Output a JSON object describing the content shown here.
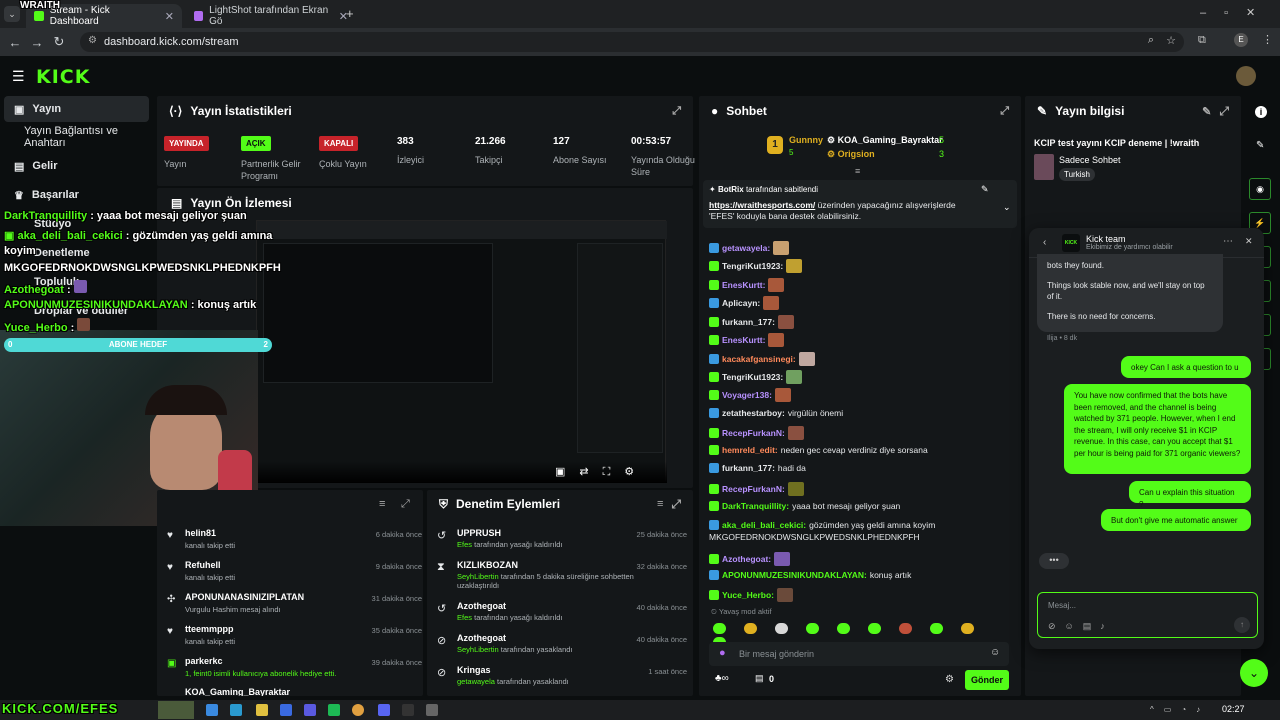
{
  "browser": {
    "tabs": [
      {
        "label": "Stream - Kick Dashboard",
        "active": true
      },
      {
        "label": "LightShot tarafından Ekran Gö",
        "active": false
      }
    ],
    "url": "dashboard.kick.com/stream",
    "profile_initial": "E"
  },
  "overlay": {
    "wraith": "WRAITH",
    "stream_watermark": "KICK.COM/EFES",
    "sub_goal": "ABONE HEDEF",
    "sub_goal_left": "0",
    "sub_goal_right": "2",
    "chat": [
      {
        "user": "DarkTranquillity",
        "text": ": yaaa bot mesajı geliyor şuan"
      },
      {
        "user": "aka_deli_bali_cekici",
        "text": ": gözümden yaş geldi amına"
      },
      {
        "user": "",
        "text": "koyim"
      },
      {
        "user": "",
        "text": "MKGOFEDRNOKDWSNGLKPWEDSNKLPHEDNKPFH"
      },
      {
        "user": "Azothegoat",
        "text": ":"
      },
      {
        "user": "APONUNMUZESINIKUNDAKLAYAN",
        "text": ": konuş artık"
      },
      {
        "user": "Yuce_Herbo",
        "text": ":"
      }
    ]
  },
  "sidebar": {
    "items": [
      {
        "label": "Yayın",
        "icon": "broadcast-icon"
      },
      {
        "label": "Yayın Bağlantısı ve Anahtarı",
        "icon": ""
      },
      {
        "label": "Gelir",
        "icon": "money-icon"
      },
      {
        "label": "Başarılar",
        "icon": "trophy-icon"
      },
      {
        "label": "Stüdyo",
        "icon": "studio-icon"
      },
      {
        "label": "Denetleme",
        "icon": "shield-icon"
      },
      {
        "label": "Topluluk",
        "icon": "people-icon"
      },
      {
        "label": "Droplar ve ödüller",
        "icon": "gift-icon"
      }
    ]
  },
  "stats": {
    "title": "Yayın İstatistikleri",
    "items": [
      {
        "badge": "YAYINDA",
        "label": "Yayın"
      },
      {
        "badge": "AÇIK",
        "label": "Partnerlik Gelir Programı"
      },
      {
        "badge": "KAPALI",
        "label": "Çoklu Yayın"
      },
      {
        "value": "383",
        "label": "İzleyici"
      },
      {
        "value": "21.266",
        "label": "Takipçi"
      },
      {
        "value": "127",
        "label": "Abone Sayısı"
      },
      {
        "value": "00:53:57",
        "label": "Yayında Olduğu Süre"
      }
    ]
  },
  "preview": {
    "title": "Yayın Ön İzlemesi"
  },
  "followers": {
    "items": [
      {
        "name": "helin81",
        "sub": "kanalı takip etti",
        "time": "6 dakika önce",
        "icon": "heart-icon"
      },
      {
        "name": "Refuhell",
        "sub": "kanalı takip etti",
        "time": "9 dakika önce",
        "icon": "heart-icon"
      },
      {
        "name": "APONUNANASINIZIPLATAN",
        "sub": "Vurgulu Hashim mesaj alındı",
        "time": "31 dakika önce",
        "icon": "highlight-icon"
      },
      {
        "name": "tteemmppp",
        "sub": "kanalı takip etti",
        "time": "35 dakika önce",
        "icon": "heart-icon"
      },
      {
        "name": "parkerkc",
        "sub": "1, feint0 isimli kullanıcıya abonelik hediye etti.",
        "time": "39 dakika önce",
        "icon": "gift-icon"
      },
      {
        "name": "KOA_Gaming_Bayraktar",
        "sub": "",
        "time": "",
        "icon": "heart-icon"
      }
    ]
  },
  "moderation": {
    "title": "Denetim Eylemleri",
    "items": [
      {
        "name": "UPPRUSH",
        "actor": "Efes",
        "sub": "tarafından yasağı kaldırıldı",
        "time": "25 dakika önce",
        "icon": "unban-icon"
      },
      {
        "name": "KIZLIKBOZAN",
        "actor": "SeyhLibertin",
        "sub": "tarafından 5 dakika süreliğine sohbetten uzaklaştırıldı",
        "time": "32 dakika önce",
        "icon": "timeout-icon"
      },
      {
        "name": "Azothegoat",
        "actor": "Efes",
        "sub": "tarafından yasağı kaldırıldı",
        "time": "40 dakika önce",
        "icon": "unban-icon"
      },
      {
        "name": "Azothegoat",
        "actor": "SeyhLibertin",
        "sub": "tarafından yasaklandı",
        "time": "40 dakika önce",
        "icon": "ban-icon"
      },
      {
        "name": "Kringas",
        "actor": "getawayela",
        "sub": "tarafından yasaklandı",
        "time": "1 saat önce",
        "icon": "ban-icon"
      }
    ]
  },
  "chat": {
    "title": "Sohbet",
    "leader_rank": "1",
    "leader_name": "Gunnny",
    "leader_subs": "5",
    "gifters": [
      {
        "name": "KOA_Gaming_Bayraktar",
        "count": "5"
      },
      {
        "name": "Origsion",
        "count": "3"
      }
    ],
    "pinned_by": "BotRix",
    "pinned_by_suffix": "tarafından sabitlendi",
    "pinned_link": "https://wraithesports.com/",
    "pinned_text1": " üzerinden yapacağınız alışverişlerde",
    "pinned_text2": "'EFES' koduyla bana destek olabilirsiniz.",
    "messages": [
      {
        "user": "getawayela:",
        "text": "",
        "color": "#b892ff"
      },
      {
        "user": "TengriKut1923:",
        "text": "",
        "color": "#e6e8ea"
      },
      {
        "user": "EnesKurtt:",
        "text": "",
        "color": "#b892ff"
      },
      {
        "user": "Aplicayn:",
        "text": "",
        "color": "#e6e8ea"
      },
      {
        "user": "furkann_177:",
        "text": "",
        "color": "#e6e8ea"
      },
      {
        "user": "EnesKurtt:",
        "text": "",
        "color": "#b892ff"
      },
      {
        "user": "kacakafgansinegi:",
        "text": "",
        "color": "#ff8a5b"
      },
      {
        "user": "TengriKut1923:",
        "text": "",
        "color": "#e6e8ea"
      },
      {
        "user": "Voyager138:",
        "text": "",
        "color": "#b892ff"
      },
      {
        "user": "zetathestarboy:",
        "text": "virgülün önemi",
        "color": "#e6e8ea"
      },
      {
        "user": "RecepFurkanN:",
        "text": "",
        "color": "#b892ff"
      },
      {
        "user": "hemreld_edit:",
        "text": "neden gec cevap verdiniz diye sorsana",
        "color": "#ff8a5b"
      },
      {
        "user": "furkann_177:",
        "text": "hadi da",
        "color": "#e6e8ea"
      },
      {
        "user": "RecepFurkanN:",
        "text": "",
        "color": "#b892ff"
      },
      {
        "user": "DarkTranquillity:",
        "text": "yaaa bot mesajı geliyor şuan",
        "color": "#53fc18"
      },
      {
        "user": "aka_deli_bali_cekici:",
        "text": "gözümden yaş geldi amına koyim",
        "color": "#53fc18"
      },
      {
        "user": "",
        "text": "MKGOFEDRNOKDWSNGLKPWEDSNKLPHEDNKPFH",
        "color": "#e6e8ea"
      },
      {
        "user": "Azothegoat:",
        "text": "",
        "color": "#b892ff"
      },
      {
        "user": "APONUNMUZESINIKUNDAKLAYAN:",
        "text": "konuş artık",
        "color": "#53fc18"
      },
      {
        "user": "Yuce_Herbo:",
        "text": "",
        "color": "#53fc18"
      }
    ],
    "slow_mode": "Yavaş mod aktif",
    "input_placeholder": "Bir mesaj gönderin",
    "points": "0",
    "send_label": "Gönder"
  },
  "stream_info": {
    "title": "Yayın bilgisi",
    "stream_title": "KCIP test yayını KCIP deneme | !wraith",
    "category": "Sadece Sohbet",
    "tag": "Turkish"
  },
  "support": {
    "team_name": "Kick team",
    "team_sub": "Ekibimiz de yardımcı olabilir",
    "msg1_a": "bots they found.",
    "msg1_b": "Things look stable now, and we'll stay on top of it.",
    "msg1_c": "There is no need for concerns.",
    "meta": "Ilija • 8 dk",
    "user1": "okey Can I ask a question to u",
    "user2": "You have now confirmed that the bots have been removed, and the channel is being watched by 371 people. However, when I end the stream, I will only receive $1 in KCIP revenue. In this case, can you accept that $1 per hour is being paid for 371 organic viewers?",
    "user3": "Can u explain this situation ?",
    "user4": "But don't give me automatic answer",
    "input_placeholder": "Mesaj..."
  },
  "taskbar": {
    "time": "02:27"
  },
  "colors": {
    "accent": "#53fc18",
    "live": "#c7232a",
    "panel": "#141719",
    "bg": "#0b0e0f"
  }
}
